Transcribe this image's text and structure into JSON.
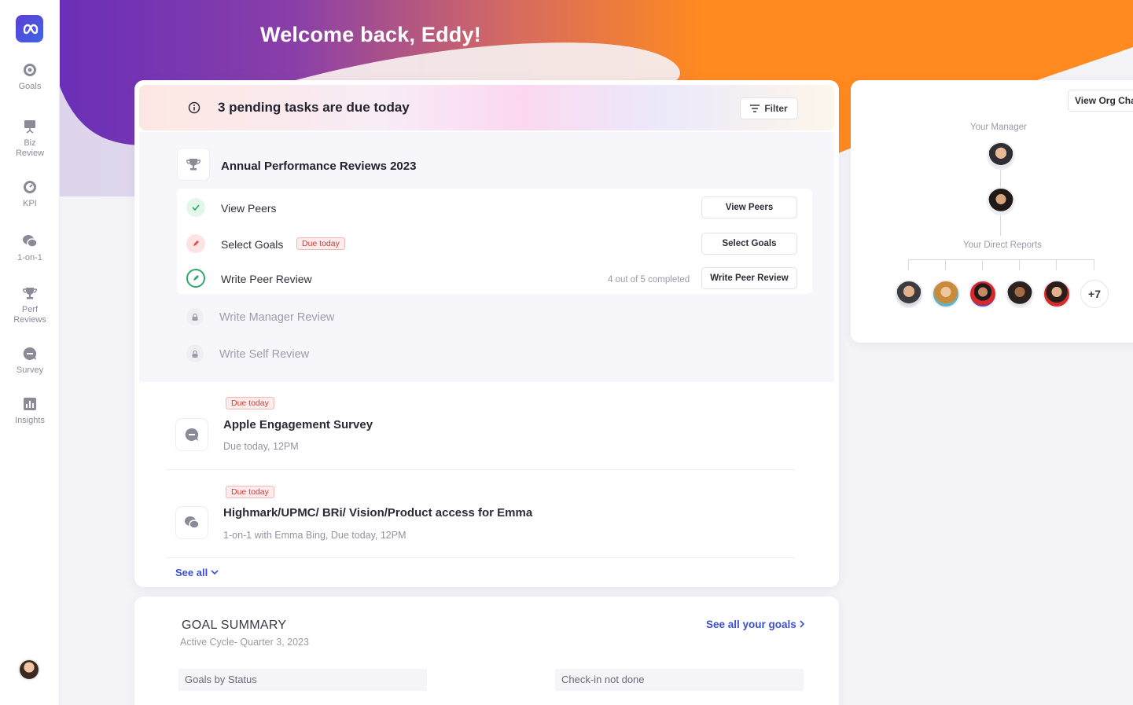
{
  "sidebar": {
    "items": [
      {
        "label": "Goals",
        "icon": "target-icon"
      },
      {
        "label": "Biz\nReview",
        "icon": "presentation-icon"
      },
      {
        "label": "KPI",
        "icon": "gauge-icon"
      },
      {
        "label": "1-on-1",
        "icon": "chat-bubbles-icon"
      },
      {
        "label": "Perf\nReviews",
        "icon": "trophy-icon"
      },
      {
        "label": "Survey",
        "icon": "survey-bubble-icon"
      },
      {
        "label": "Insights",
        "icon": "bar-chart-icon"
      }
    ]
  },
  "header": {
    "welcome": "Welcome back, Eddy!"
  },
  "pending": {
    "text": "3 pending tasks are due today",
    "filter_label": "Filter"
  },
  "review": {
    "title": "Annual Performance Reviews 2023",
    "steps": [
      {
        "label": "View Peers",
        "button": "View Peers",
        "status": "done"
      },
      {
        "label": "Select Goals",
        "badge": "Due today",
        "button": "Select Goals",
        "status": "due"
      },
      {
        "label": "Write Peer Review",
        "progress": "4 out of 5 completed",
        "button": "Write Peer Review",
        "status": "in-progress"
      }
    ],
    "locked": [
      {
        "label": "Write Manager Review"
      },
      {
        "label": "Write Self Review"
      }
    ]
  },
  "tasks": [
    {
      "badge": "Due today",
      "title": "Apple Engagement Survey",
      "subtitle": "Due today, 12PM"
    },
    {
      "badge": "Due today",
      "title": "Highmark/UPMC/ BRi/ Vision/Product access for Emma",
      "subtitle": "1-on-1 with Emma Bing, Due today, 12PM"
    }
  ],
  "see_all": "See all",
  "goal_summary": {
    "title": "GOAL SUMMARY",
    "cycle": "Active Cycle- Quarter 3, 2023",
    "link": "See all your goals",
    "col1": "Goals by Status",
    "col2": "Check-in not done"
  },
  "org": {
    "button": "View Org Chart",
    "manager_label": "Your Manager",
    "reports_label": "Your Direct Reports",
    "more_count": "+7"
  },
  "colors": {
    "accent": "#3b4fcf",
    "hero_purple": "#6b2fb8",
    "hero_orange": "#ff8a1f",
    "due_red": "#c8413b",
    "done_green": "#2fa866"
  }
}
